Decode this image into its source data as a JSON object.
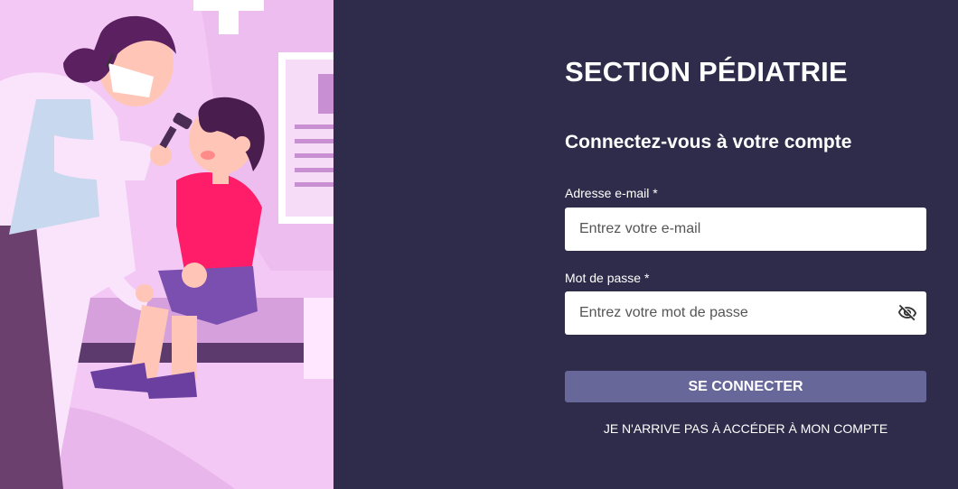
{
  "section_title": "SECTION PÉDIATRIE",
  "form": {
    "heading": "Connectez-vous à votre compte",
    "email": {
      "label": "Adresse e-mail *",
      "placeholder": "Entrez votre e-mail",
      "value": ""
    },
    "password": {
      "label": "Mot de passe *",
      "placeholder": "Entrez votre mot de passe",
      "value": "",
      "visibility_icon": "eye-off-icon"
    },
    "submit_label": "SE CONNECTER",
    "help_link": "JE N'ARRIVE PAS À ACCÉDER À MON COMPTE"
  },
  "illustration": {
    "subject": "doctor examining child with otoscope",
    "icons": [
      "medical-cross-icon",
      "otoscope-icon"
    ]
  },
  "colors": {
    "panel_background": "#2e2c4a",
    "button": "#67679a",
    "illustration_background": "#f3c8f4"
  }
}
